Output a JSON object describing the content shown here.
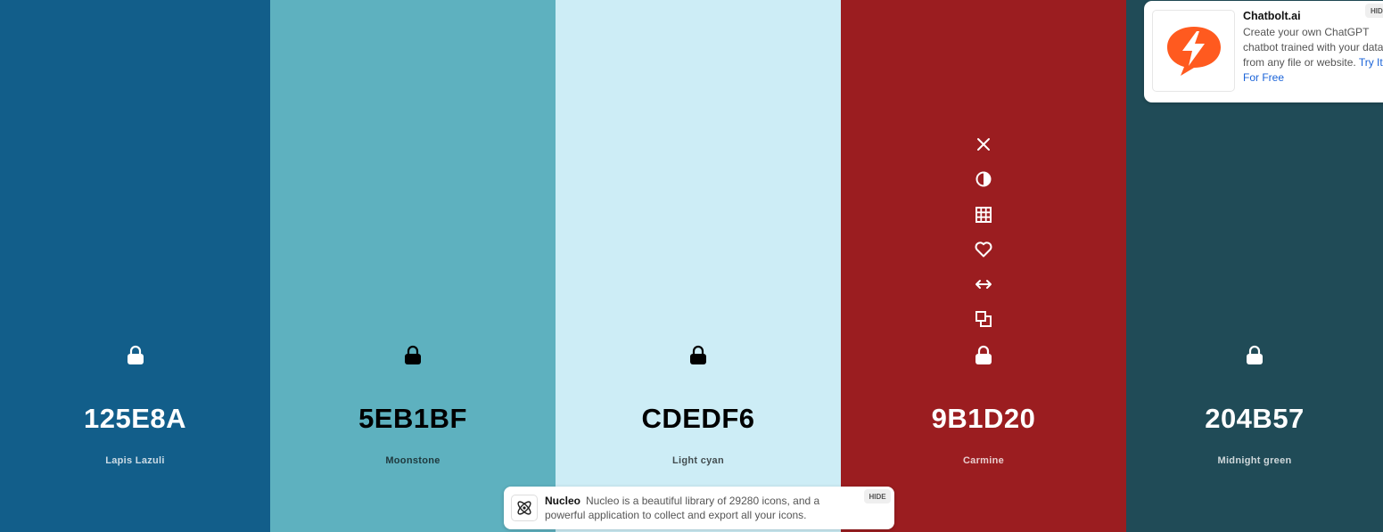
{
  "palette": {
    "colors": [
      {
        "hex": "125E8A",
        "name": "Lapis Lazuli",
        "bg": "#125E8A",
        "text_theme": "light"
      },
      {
        "hex": "5EB1BF",
        "name": "Moonstone",
        "bg": "#5EB1BF",
        "text_theme": "dark"
      },
      {
        "hex": "CDEDF6",
        "name": "Light cyan",
        "bg": "#CDEDF6",
        "text_theme": "dark"
      },
      {
        "hex": "9B1D20",
        "name": "Carmine",
        "bg": "#9B1D20",
        "text_theme": "light"
      },
      {
        "hex": "204B57",
        "name": "Midnight green",
        "bg": "#204B57",
        "text_theme": "light"
      }
    ],
    "hovered_tools": [
      "close-icon",
      "contrast-icon",
      "shades-grid-icon",
      "heart-icon",
      "drag-arrows-icon",
      "copy-icon"
    ]
  },
  "ad": {
    "title": "Chatbolt.ai",
    "text": "Create your own ChatGPT chatbot trained with your data from any file or website.",
    "cta": "Try It For Free",
    "hide": "HIDE",
    "brand_color": "#FF5A1F"
  },
  "toast": {
    "title": "Nucleo",
    "text": "Nucleo is a beautiful library of 29280 icons, and a powerful application to collect and export all your icons.",
    "hide": "HIDE"
  }
}
